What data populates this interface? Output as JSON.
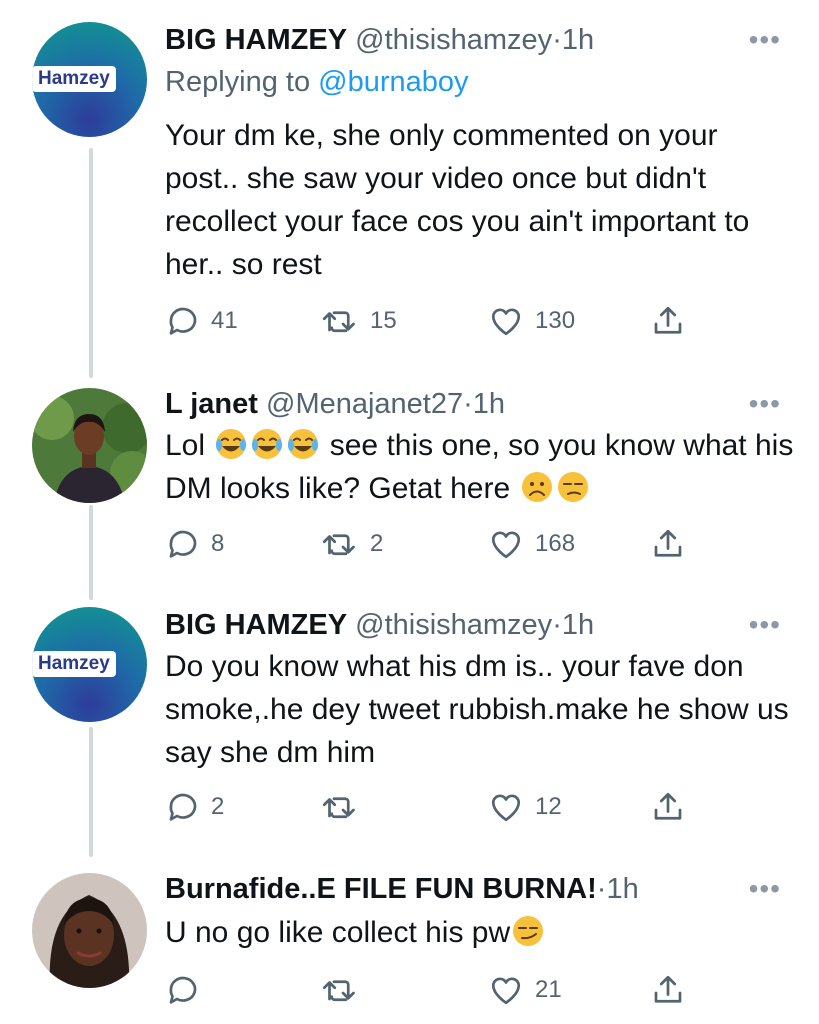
{
  "tweets": [
    {
      "name": "BIG HAMZEY",
      "handle": "@thisishamzey",
      "time": "1h",
      "avatar_label": "Hamzey",
      "replying_prefix": "Replying to",
      "replying_to": "@burnaboy",
      "text": "Your dm ke, she only commented on your post.. she saw your video once but didn't recollect your face cos you ain't important to her.. so rest",
      "replies": "41",
      "retweets": "15",
      "likes": "130"
    },
    {
      "name": "L janet",
      "handle": "@Menajanet27",
      "time": "1h",
      "text_part1": "Lol",
      "text_part2": " see this one, so you know what his DM looks like? Getat here",
      "emojis_1": [
        "face-with-tears-of-joy",
        "face-with-tears-of-joy",
        "face-with-tears-of-joy"
      ],
      "emojis_2": [
        "frowning-face",
        "unamused-face"
      ],
      "replies": "8",
      "retweets": "2",
      "likes": "168"
    },
    {
      "name": "BIG HAMZEY",
      "handle": "@thisishamzey",
      "time": "1h",
      "avatar_label": "Hamzey",
      "text": "Do you know what his dm is.. your fave don smoke,.he dey tweet rubbish.make he show us say she dm him",
      "replies": "2",
      "retweets": "",
      "likes": "12"
    },
    {
      "name": "Burnafide..E FILE FUN BURNA!",
      "handle": "",
      "time": "1h",
      "text": "U no go like collect his pw",
      "emojis": [
        "smirking-face"
      ],
      "replies": "",
      "retweets": "",
      "likes": "21"
    }
  ],
  "ui": {
    "dot": "·",
    "more": "•••"
  },
  "colors": {
    "secondary_text": "#536471",
    "link": "#1d9bf0",
    "thread_line": "#cfd9de",
    "emoji_yellow": "#f7c13b"
  }
}
